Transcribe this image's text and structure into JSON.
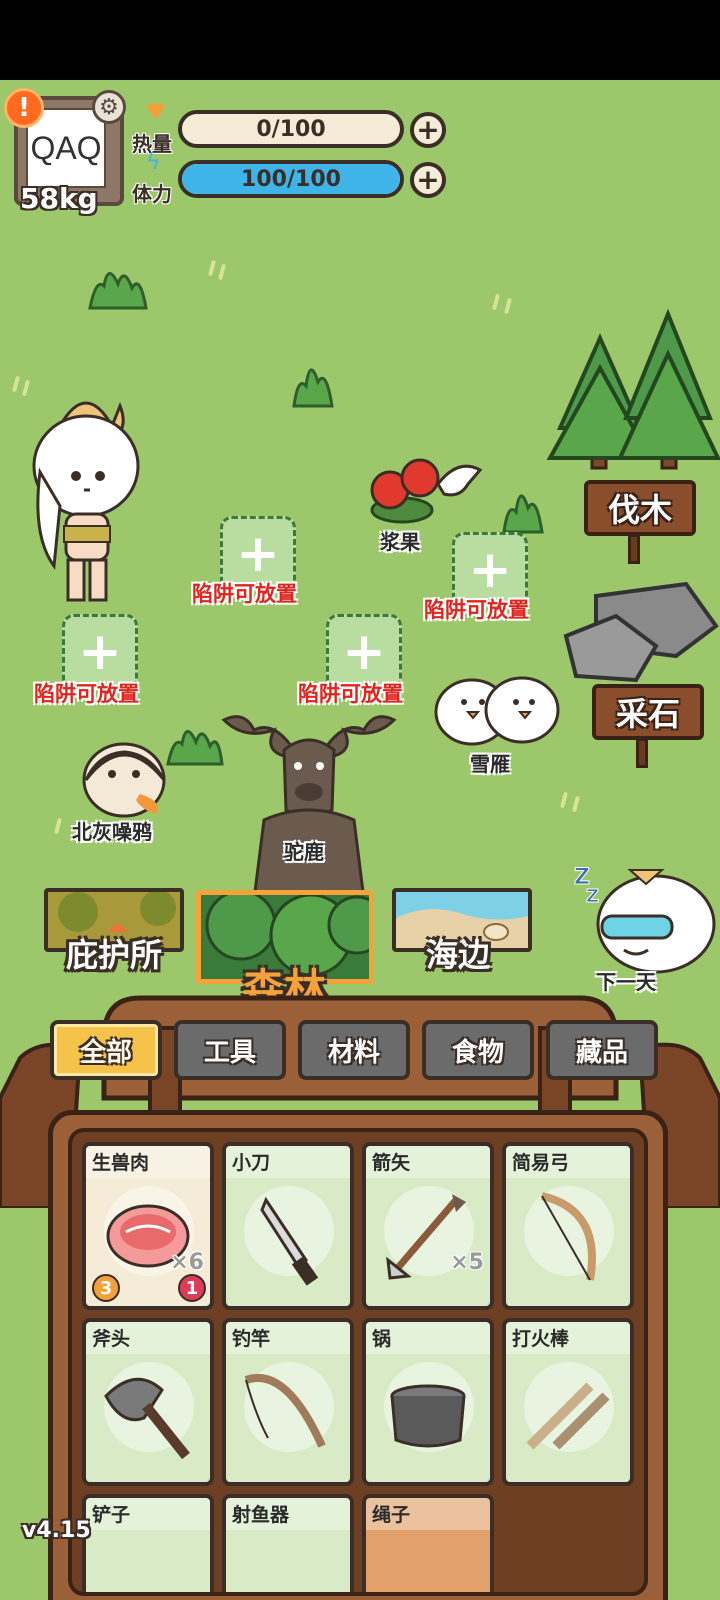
{
  "profile": {
    "avatar_text": "QAQ",
    "alert_symbol": "!",
    "weight": "58kg"
  },
  "stats": {
    "calories": {
      "label": "热量",
      "value": "0/100",
      "fraction": 0.0
    },
    "stamina": {
      "label": "体力",
      "value": "100/100",
      "fraction": 1.0
    },
    "plus_symbol": "+"
  },
  "world": {
    "berry_label": "浆果",
    "goose_label": "雪雁",
    "crow_label": "北灰噪鸦",
    "moose_label": "驼鹿",
    "trap_label": "陷阱可放置",
    "trap_plus": "+",
    "signs": {
      "chop": "伐木",
      "mine": "采石"
    },
    "next_day_label": "下一天",
    "sleep_symbol": "Z"
  },
  "locations": {
    "shelter": "庇护所",
    "forest": "森林",
    "beach": "海边",
    "active": "forest"
  },
  "bag": {
    "categories": [
      "全部",
      "工具",
      "材料",
      "食物",
      "藏品"
    ],
    "active_category": "全部",
    "items": [
      {
        "name": "生兽肉",
        "count": "×6",
        "calorie_badge": "3",
        "fresh_badge": "1",
        "type": "food"
      },
      {
        "name": "小刀",
        "count": "",
        "type": "tool"
      },
      {
        "name": "箭矢",
        "count": "×5",
        "type": "tool"
      },
      {
        "name": "简易弓",
        "count": "",
        "type": "tool"
      },
      {
        "name": "斧头",
        "count": "",
        "type": "tool"
      },
      {
        "name": "钓竿",
        "count": "",
        "type": "tool"
      },
      {
        "name": "锅",
        "count": "",
        "type": "tool"
      },
      {
        "name": "打火棒",
        "count": "",
        "type": "tool"
      },
      {
        "name": "铲子",
        "count": "",
        "type": "tool"
      },
      {
        "name": "射鱼器",
        "count": "",
        "type": "tool"
      },
      {
        "name": "绳子",
        "count": "",
        "type": "material"
      }
    ]
  },
  "version": "v4.15",
  "colors": {
    "grass": "#9cc76a",
    "trap_text": "#e3231c",
    "active_tab": "#f5c24a",
    "bag_brown": "#9b6038",
    "stamina_blue": "#3fb4e8"
  }
}
